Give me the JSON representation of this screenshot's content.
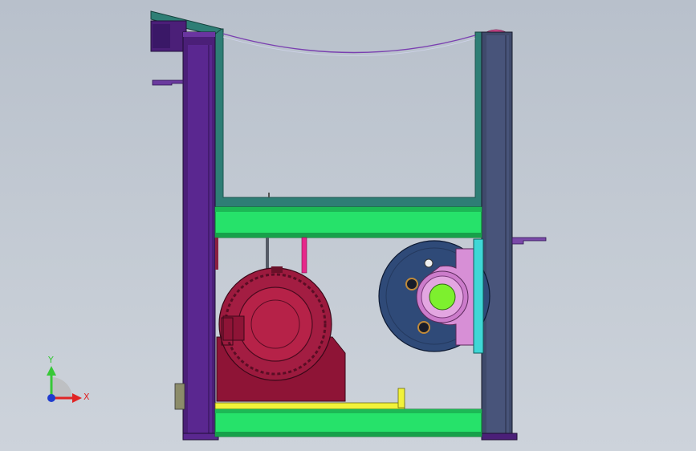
{
  "scene": {
    "background_top": "#b8c0cb",
    "background_bottom": "#cdd3db"
  },
  "parts": {
    "left_column": "#4b1f78",
    "right_column": "#3f4a6b",
    "hopper": "#2e7e75",
    "cross_beam": "#26e26a",
    "motor": "#8e1436",
    "bearing_disc": "#2f4a78",
    "bearing_housing": "#d78fd6",
    "shaft": "#7df02e",
    "mount_plate": "#3fd7d6",
    "rail": "#f2f23a",
    "pink_rod": "#e6288a"
  },
  "triad": {
    "y_label": "Y",
    "x_label": "X",
    "y_color": "#37c837",
    "x_color": "#e02424",
    "z_color": "#1f3ccf"
  }
}
